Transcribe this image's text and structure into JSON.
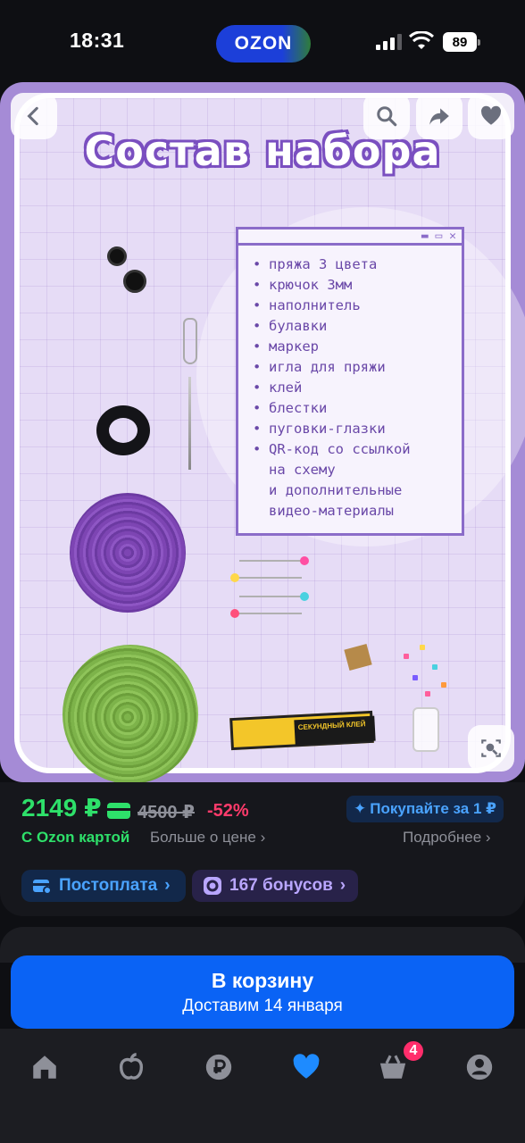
{
  "status": {
    "time": "18:31",
    "battery": "89",
    "app_badge": "OZON"
  },
  "hero": {
    "title": "Состав набора",
    "items": [
      {
        "text": "пряжа 3 цвета",
        "bullet": true
      },
      {
        "text": "крючок 3мм",
        "bullet": true
      },
      {
        "text": "наполнитель",
        "bullet": true
      },
      {
        "text": "булавки",
        "bullet": true
      },
      {
        "text": "маркер",
        "bullet": true
      },
      {
        "text": "игла для пряжи",
        "bullet": true
      },
      {
        "text": "клей",
        "bullet": true
      },
      {
        "text": "блестки",
        "bullet": true
      },
      {
        "text": "пуговки-глазки",
        "bullet": true
      },
      {
        "text": "QR-код со ссылкой",
        "bullet": true
      },
      {
        "text": "на схему",
        "bullet": false
      },
      {
        "text": "и дополнительные",
        "bullet": false
      },
      {
        "text": "видео-материалы",
        "bullet": false
      }
    ],
    "glue_label": "СЕКУНДНЫЙ КЛЕЙ"
  },
  "price": {
    "current": "2149 ₽",
    "old": "4500 ₽",
    "discount": "-52%",
    "promo": "Покупайте за 1 ₽",
    "ozon_card": "С Ozon картой",
    "more": "Больше о цене",
    "details": "Подробнее"
  },
  "pills": {
    "postpay": "Постоплата",
    "bonus": "167 бонусов"
  },
  "cart": {
    "title": "В корзину",
    "subtitle": "Доставим 14 января"
  },
  "tabbar": {
    "cart_count": "4"
  },
  "colors": {
    "accent": "#0a63f5",
    "price_green": "#2ee06a",
    "discount_red": "#ff3b6b"
  }
}
